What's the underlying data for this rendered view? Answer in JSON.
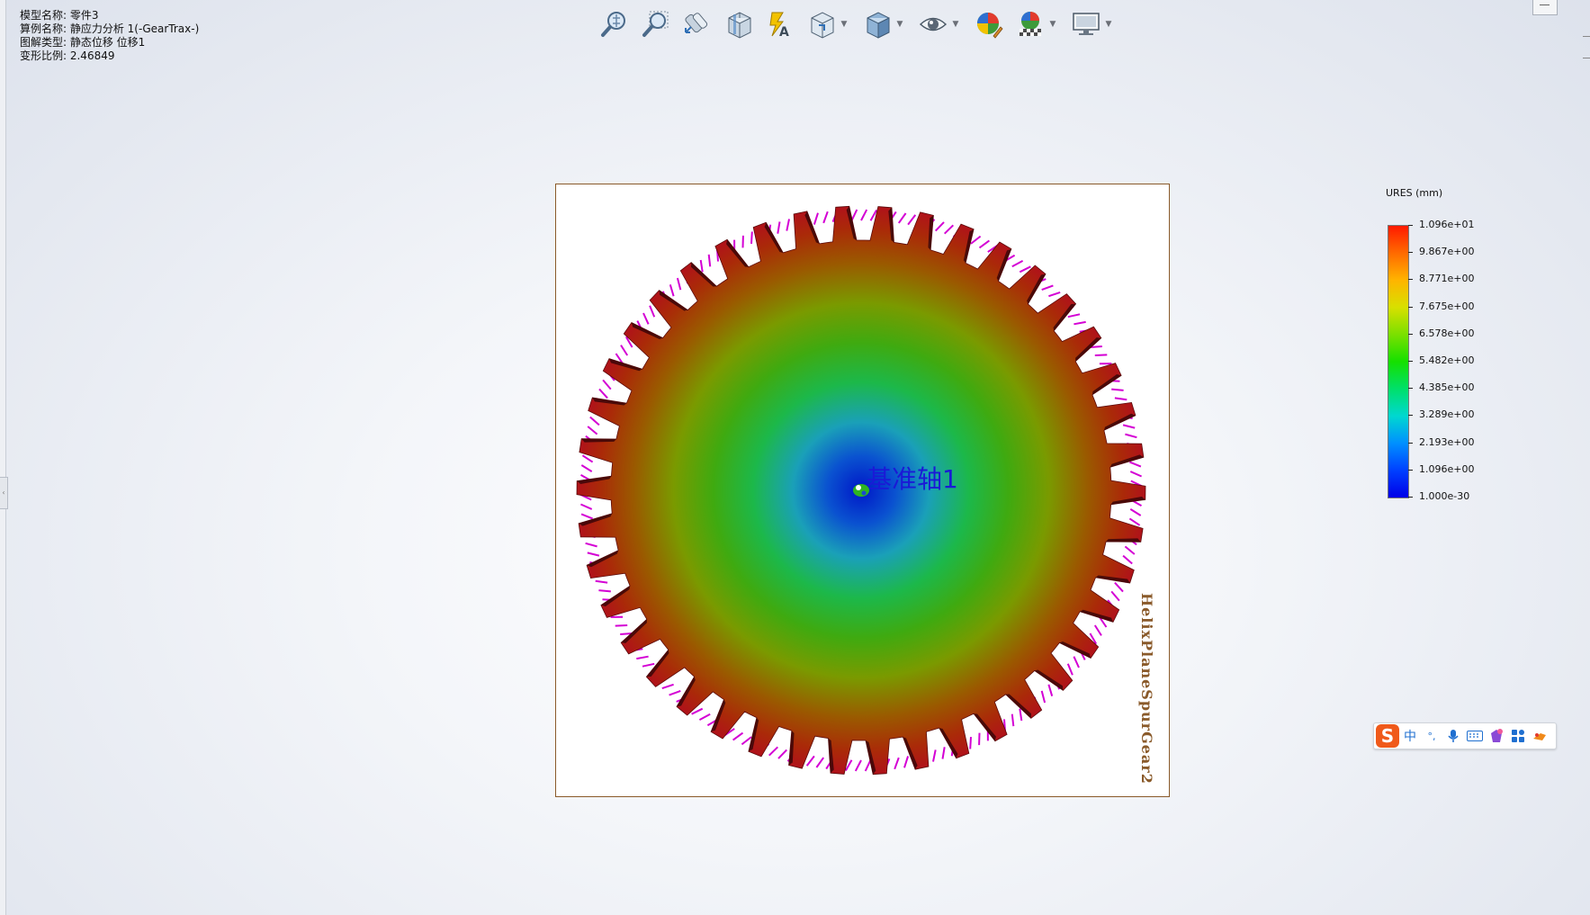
{
  "info": {
    "model_name": "模型名称: 零件3",
    "study_name": "算例名称: 静应力分析 1(-GearTrax-)",
    "plot_type": "图解类型: 静态位移 位移1",
    "deformation_scale": "变形比例: 2.46849"
  },
  "toolbar": {
    "icons": [
      "zoom-to-fit-icon",
      "zoom-to-area-icon",
      "previous-view-icon",
      "section-view-icon",
      "dynamic-annotation-icon",
      "view-orientation-icon",
      "display-style-icon",
      "hide-show-items-icon",
      "edit-appearance-icon",
      "apply-scene-icon",
      "view-settings-icon"
    ]
  },
  "viewport": {
    "axis_label": "基准轴1",
    "body_label": "HelixPlaneSpurGear2",
    "teeth_count": 42
  },
  "legend": {
    "title": "URES (mm)",
    "labels": [
      "1.096e+01",
      "9.867e+00",
      "8.771e+00",
      "7.675e+00",
      "6.578e+00",
      "5.482e+00",
      "4.385e+00",
      "3.289e+00",
      "2.193e+00",
      "1.096e+00",
      "1.000e-30"
    ]
  },
  "ime": {
    "logo": "S",
    "mode": "中",
    "punct": "°,",
    "items": [
      "voice-icon",
      "keyboard-icon",
      "skin-icon",
      "toolbox-icon",
      "more-icon"
    ]
  },
  "colors": {
    "frame": "#8a5a2a",
    "axis_label": "#1a1ad6",
    "gear_outer": "#b0121a",
    "gear_mid": "#2fa400",
    "gear_center": "#0a2fb0",
    "restraint": "#d400d4"
  }
}
